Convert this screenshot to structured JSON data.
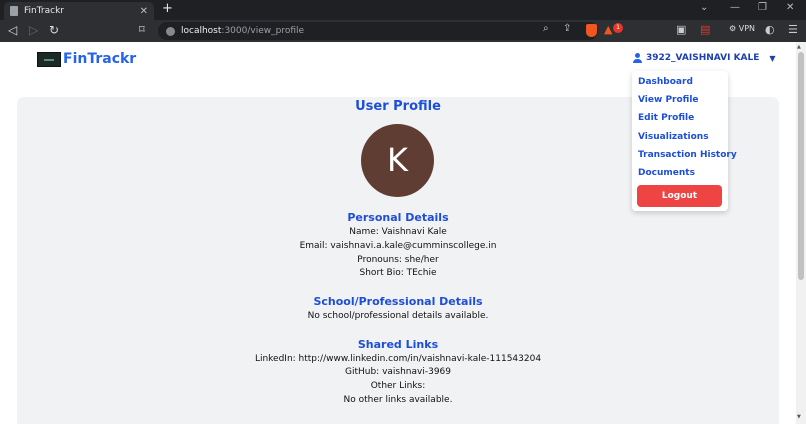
{
  "browser": {
    "tab_title": "FinTrackr",
    "new_tab": "+",
    "url_host": "localhost",
    "url_path": ":3000/view_profile",
    "badge_count": "1",
    "vpn_label": "VPN"
  },
  "header": {
    "brand": "FinTrackr",
    "user_name": "3922_VAISHNAVI KALE"
  },
  "dropdown": {
    "items": [
      "Dashboard",
      "View Profile",
      "Edit Profile",
      "Visualizations",
      "Transaction History",
      "Documents"
    ],
    "logout": "Logout"
  },
  "profile": {
    "title": "User Profile",
    "avatar_letter": "K",
    "avatar_color": "#5f3d33",
    "personal": {
      "heading": "Personal Details",
      "name": "Name: Vaishnavi Kale",
      "email": "Email: vaishnavi.a.kale@cumminscollege.in",
      "pronouns": "Pronouns: she/her",
      "bio": "Short Bio: TEchie"
    },
    "school": {
      "heading": "School/Professional Details",
      "text": "No school/professional details available."
    },
    "links": {
      "heading": "Shared Links",
      "linkedin": "LinkedIn: http://www.linkedin.com/in/vaishnavi-kale-111543204",
      "github": "GitHub: vaishnavi-3969",
      "other_label": "Other Links:",
      "other_text": "No other links available."
    }
  },
  "colors": {
    "accent": "#1d4ed8",
    "logout": "#ef4444",
    "card": "#f1f2f4"
  }
}
